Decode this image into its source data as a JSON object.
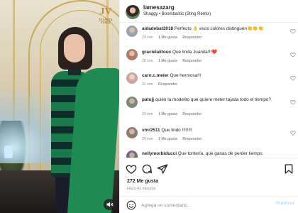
{
  "media": {
    "watermark_letters": "JV",
    "watermark_caption": "JUANITA VIALE"
  },
  "header": {
    "username": "lamesazarg",
    "song": "Shaggy • Boombastic (Sting Remix)"
  },
  "comments": [
    {
      "user": "aidadebat2018",
      "text": "Perfecto 👌 esos colores distinguen👏👏👏",
      "age": "29 min",
      "likes": "1 Me gusta",
      "reply": "Responder",
      "avatar_color": "#9aa3ad"
    },
    {
      "user": "gracielalitoux",
      "text": "Qué linda Juanita!!!❤️",
      "age": "28 min",
      "likes": "1 Me gusta",
      "reply": "Responder",
      "avatar_color": "#b07b6a"
    },
    {
      "user": "caro.c.meier",
      "text": "Que hermosa!!!",
      "age": "32 min",
      "likes": "",
      "reply": "Responder",
      "avatar_color": "#c9a6a0"
    },
    {
      "user": "patojj",
      "text": "quién la modelito que quiere meter tajada todo el tiempo?",
      "age": "29 min",
      "likes": "1 Me gusta",
      "reply": "Responder",
      "avatar_color": "#7a8a7c"
    },
    {
      "user": "vmr2511",
      "text": "Que lindo !!!!!!!!",
      "age": "29 min",
      "likes": "1 Me gusta",
      "reply": "Responder",
      "avatar_color": "#8b7d74"
    },
    {
      "user": "nellymorbiducci",
      "text": "Que tontería, que ganas de perder tiempo",
      "age": "",
      "likes": "",
      "reply": "",
      "avatar_color": "#6f6a86"
    }
  ],
  "stats": {
    "likes": "272 Me gusta",
    "time_ago": "Hace 41 minutos"
  },
  "composer": {
    "placeholder": "Agrega un comentario...",
    "post_label": "Publicar"
  },
  "icons": [
    "heart-icon",
    "comment-icon",
    "share-icon",
    "bookmark-icon",
    "emoji-icon",
    "mute-icon"
  ],
  "colors": {
    "link_blue": "#b2dffc",
    "muted_text": "#8e8e8e",
    "like_red": "#ed4956"
  }
}
